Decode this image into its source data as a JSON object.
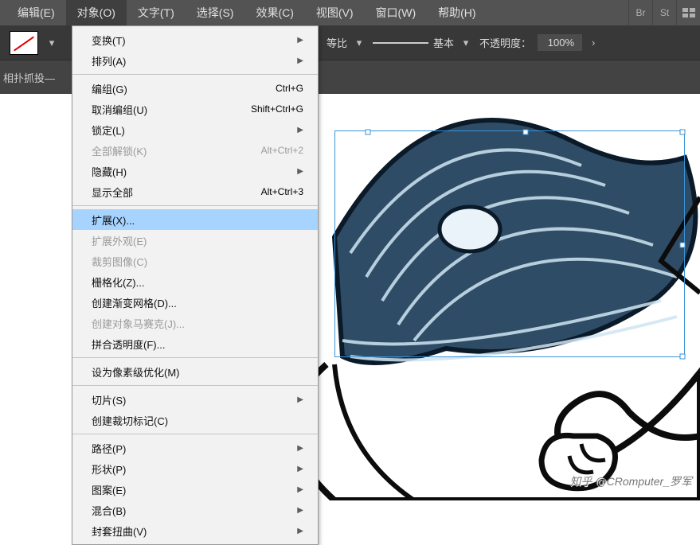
{
  "menubar": {
    "items": [
      {
        "label": "编辑(E)"
      },
      {
        "label": "对象(O)",
        "active": true
      },
      {
        "label": "文字(T)"
      },
      {
        "label": "选择(S)"
      },
      {
        "label": "效果(C)"
      },
      {
        "label": "视图(V)"
      },
      {
        "label": "窗口(W)"
      },
      {
        "label": "帮助(H)"
      }
    ],
    "icon1": "Br",
    "icon2": "St"
  },
  "optbar": {
    "scale_label": "等比",
    "stroke_label": "基本",
    "opacity_label": "不透明度：",
    "opacity_value": "100%"
  },
  "tabstrip": {
    "label": "相扑抓投—"
  },
  "dropdown": {
    "items": [
      {
        "label": "变换(T)",
        "sub": "arrow"
      },
      {
        "label": "排列(A)",
        "sub": "arrow"
      },
      {
        "sep": true
      },
      {
        "label": "编组(G)",
        "sc": "Ctrl+G"
      },
      {
        "label": "取消编组(U)",
        "sc": "Shift+Ctrl+G"
      },
      {
        "label": "锁定(L)",
        "sub": "arrow"
      },
      {
        "label": "全部解锁(K)",
        "sc": "Alt+Ctrl+2",
        "disabled": true
      },
      {
        "label": "隐藏(H)",
        "sub": "arrow"
      },
      {
        "label": "显示全部",
        "sc": "Alt+Ctrl+3"
      },
      {
        "sep": true
      },
      {
        "label": "扩展(X)...",
        "hl": true
      },
      {
        "label": "扩展外观(E)",
        "disabled": true
      },
      {
        "label": "裁剪图像(C)",
        "disabled": true
      },
      {
        "label": "栅格化(Z)..."
      },
      {
        "label": "创建渐变网格(D)..."
      },
      {
        "label": "创建对象马赛克(J)...",
        "disabled": true
      },
      {
        "label": "拼合透明度(F)..."
      },
      {
        "sep": true
      },
      {
        "label": "设为像素级优化(M)"
      },
      {
        "sep": true
      },
      {
        "label": "切片(S)",
        "sub": "arrow"
      },
      {
        "label": "创建裁切标记(C)"
      },
      {
        "sep": true
      },
      {
        "label": "路径(P)",
        "sub": "arrow"
      },
      {
        "label": "形状(P)",
        "sub": "arrow"
      },
      {
        "label": "图案(E)",
        "sub": "arrow"
      },
      {
        "label": "混合(B)",
        "sub": "arrow"
      },
      {
        "label": "封套扭曲(V)",
        "sub": "arrow"
      }
    ]
  },
  "watermark": "知乎 @CRomputer_罗军"
}
